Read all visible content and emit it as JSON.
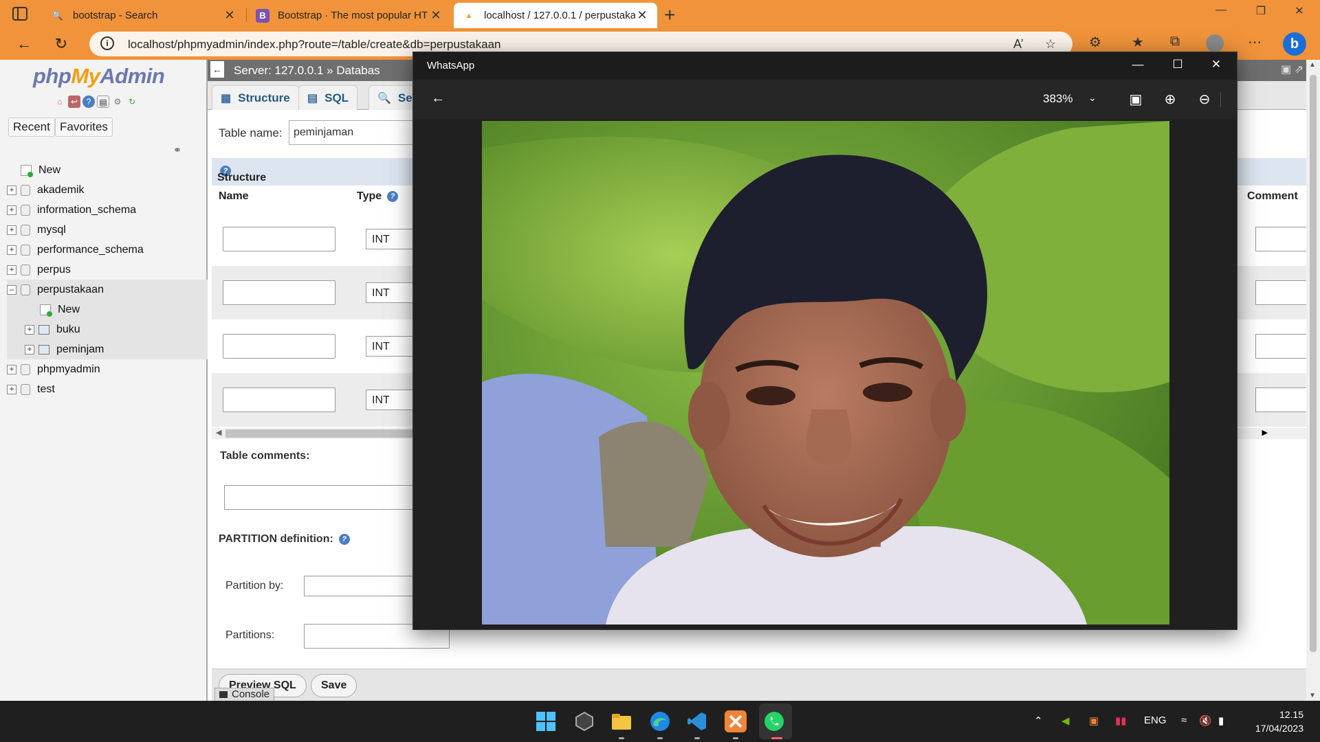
{
  "browser": {
    "tabs": [
      {
        "title": "bootstrap - Search",
        "icon": "search-icon"
      },
      {
        "title": "Bootstrap · The most popular HT",
        "icon": "bootstrap-icon"
      },
      {
        "title": "localhost / 127.0.0.1 / perpustaka",
        "icon": "phpmyadmin-icon"
      }
    ],
    "url": "localhost/phpmyadmin/index.php?route=/table/create&db=perpustakaan",
    "accent": "#f0933a"
  },
  "pma": {
    "logo_php": "php",
    "logo_my": "My",
    "logo_admin": "Admin",
    "recent": "Recent",
    "favorites": "Favorites",
    "tree": {
      "new": "New",
      "db1": "akademik",
      "db2": "information_schema",
      "db3": "mysql",
      "db4": "performance_schema",
      "db5": "perpus",
      "db6": "perpustakaan",
      "sub_new": "New",
      "sub1": "buku",
      "sub2": "peminjam",
      "db7": "phpmyadmin",
      "db8": "test"
    },
    "breadcrumb_server": "Server: 127.0.0.1",
    "breadcrumb_db": "Databas",
    "tabs": {
      "structure": "Structure",
      "sql": "SQL",
      "search": "Sea"
    },
    "table_name_label": "Table name:",
    "table_name_value": "peminjaman",
    "structure_label": "Structure",
    "col_name": "Name",
    "col_type": "Type",
    "col_comments": "Comment",
    "rows": [
      {
        "type": "INT"
      },
      {
        "type": "INT"
      },
      {
        "type": "INT"
      },
      {
        "type": "INT"
      }
    ],
    "table_comments_label": "Table comments:",
    "partition_label": "PARTITION definition:",
    "partition_by_label": "Partition by:",
    "partitions_label": "Partitions:",
    "preview_sql": "Preview SQL",
    "save": "Save",
    "console": "Console"
  },
  "whatsapp": {
    "title": "WhatsApp",
    "zoom": "383%"
  },
  "taskbar": {
    "lang": "ENG",
    "time": "12.15",
    "date": "17/04/2023"
  }
}
